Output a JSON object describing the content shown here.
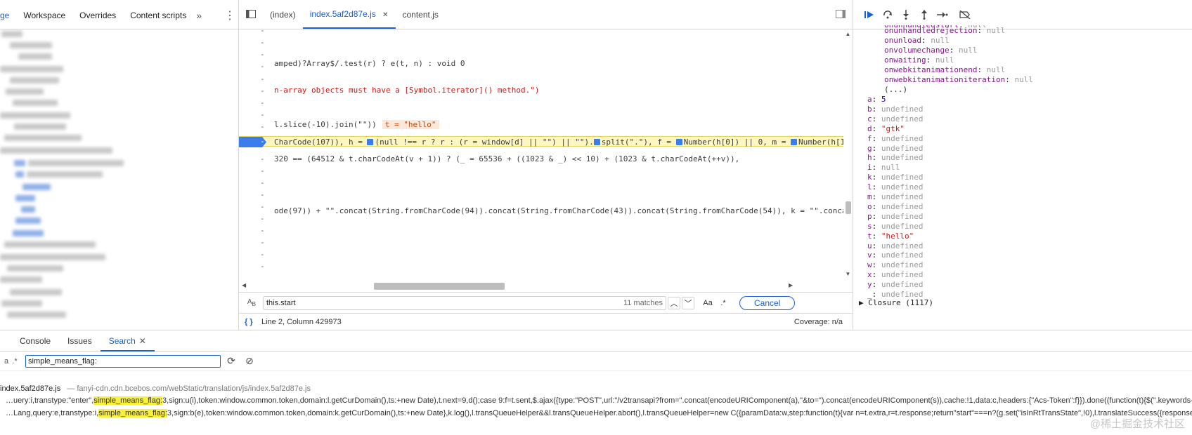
{
  "navigator": {
    "tabs": [
      {
        "label": "ge"
      },
      {
        "label": "Workspace"
      },
      {
        "label": "Overrides"
      },
      {
        "label": "Content scripts"
      }
    ],
    "more_glyph": "»",
    "menu_glyph": "⋮"
  },
  "editor": {
    "tabs": [
      {
        "label": "(index)"
      },
      {
        "label": "index.5af2d87e.js"
      },
      {
        "label": "content.js"
      }
    ],
    "lines": {
      "l1": "amped)?Array$/.test(r) ? e(t, n) : void 0",
      "l2": "n-array objects must have a [Symbol.iterator]() method.\")",
      "l3": "l.slice(-10).join(\"\"))",
      "l3_inline": "t = \"hello\"",
      "l4_a": "CharCode(107)), h = ",
      "l4_b": "(null !== r ? r : (r = window[d] || \"\") || \"\").",
      "l4_c": "split(\".\"), f = ",
      "l4_d": "Number(h[0]) || 0, m = ",
      "l4_e": "Number(h[1]) || 0, g",
      "l5": "320 == (64512 & t.charCodeAt(v + 1)) ? (_ = 65536 + ((1023 & _) << 10) + (1023 & t.charCodeAt(++v)),",
      "l6": "ode(97)) + \"\".concat(String.fromCharCode(94)).concat(String.fromCharCode(43)).concat(String.fromCharCode(54)), k = \"\".concat(String",
      "dash": "-"
    },
    "search": {
      "value": "this.start",
      "matches": "11 matches",
      "aa": "Aa",
      "regex": ".*",
      "cancel": "Cancel"
    },
    "status": {
      "position": "Line 2, Column 429973",
      "coverage": "Coverage: n/a",
      "braces": "{ }"
    }
  },
  "scope": {
    "top_props": [
      {
        "name": "onunhandledrejection",
        "value": "null"
      },
      {
        "name": "onunload",
        "value": "null"
      },
      {
        "name": "onvolumechange",
        "value": "null"
      },
      {
        "name": "onwaiting",
        "value": "null"
      },
      {
        "name": "onwebkitanimationend",
        "value": "null"
      },
      {
        "name": "onwebkitanimationiteration",
        "value": "null"
      }
    ],
    "ellipsis": "(...)",
    "locals": [
      {
        "name": "a",
        "value": "5",
        "kind": "num"
      },
      {
        "name": "b",
        "value": "undefined",
        "kind": "null"
      },
      {
        "name": "c",
        "value": "undefined",
        "kind": "null"
      },
      {
        "name": "d",
        "value": "\"gtk\"",
        "kind": "str"
      },
      {
        "name": "f",
        "value": "undefined",
        "kind": "null"
      },
      {
        "name": "g",
        "value": "undefined",
        "kind": "null"
      },
      {
        "name": "h",
        "value": "undefined",
        "kind": "null"
      },
      {
        "name": "i",
        "value": "null",
        "kind": "null"
      },
      {
        "name": "k",
        "value": "undefined",
        "kind": "null"
      },
      {
        "name": "l",
        "value": "undefined",
        "kind": "null"
      },
      {
        "name": "m",
        "value": "undefined",
        "kind": "null"
      },
      {
        "name": "o",
        "value": "undefined",
        "kind": "null"
      },
      {
        "name": "p",
        "value": "undefined",
        "kind": "null"
      },
      {
        "name": "s",
        "value": "undefined",
        "kind": "null"
      },
      {
        "name": "t",
        "value": "\"hello\"",
        "kind": "str"
      },
      {
        "name": "u",
        "value": "undefined",
        "kind": "null"
      },
      {
        "name": "v",
        "value": "undefined",
        "kind": "null"
      },
      {
        "name": "w",
        "value": "undefined",
        "kind": "null"
      },
      {
        "name": "x",
        "value": "undefined",
        "kind": "null"
      },
      {
        "name": "y",
        "value": "undefined",
        "kind": "null"
      },
      {
        "name": "_",
        "value": "undefined",
        "kind": "null"
      }
    ],
    "closure": "Closure (1117)"
  },
  "drawer": {
    "tabs": [
      {
        "label": "Console"
      },
      {
        "label": "Issues"
      },
      {
        "label": "Search"
      }
    ],
    "close_glyph": "✕",
    "query": "simple_means_flag:",
    "aa_partial": "a",
    "regex": ".*",
    "result_file": "index.5af2d87e.js",
    "result_path": "— fanyi-cdn.cdn.bcebos.com/webStatic/translation/js/index.5af2d87e.js",
    "result1": {
      "before": "…uery:i,transtype:\"enter\",",
      "match": "simple_means_flag:",
      "after": "3,sign:u(i),token:window.common.token,domain:l.getCurDomain(),ts:+new Date),t.next=9,d();case 9:f=t.sent,$.ajax({type:\"POST\",url:\"/v2transapi?from=\".concat(encodeURIComponent(a),\"&to=\").concat(encodeURIComponent(s)),cache:!1,data:c,headers:{\"Acs-Token\":f}}).done((function(t){$(\".keywords-v"
    },
    "result2": {
      "before": "…Lang,query:e,transtype:i,",
      "match": "simple_means_flag:",
      "after": "3,sign:b(e),token:window.common.token,domain:k.getCurDomain(),ts:+new Date},k.log(),l.transQueueHelper&&l.transQueueHelper.abort(),l.transQueueHelper=new C({paramData:w,step:function(t){var n=t.extra,r=t.response;return\"start\"===n?(g.set(\"isInRtTransState\",!0),l.translateSuccess({response:"
    }
  },
  "watermark": "@稀土掘金技术社区",
  "colors": {
    "accent": "#1a5fd4",
    "paused_line": "#fdf6c0",
    "highlight": "#f9f03a",
    "string": "#c41a16",
    "property": "#881391"
  }
}
